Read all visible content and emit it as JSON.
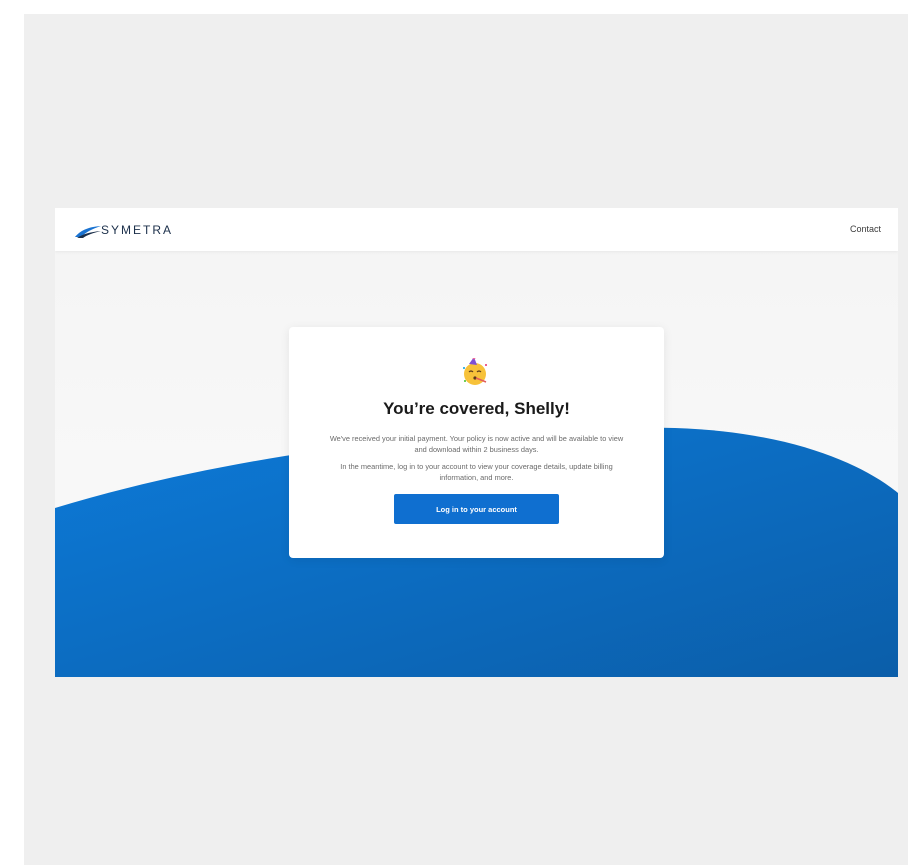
{
  "nav": {
    "brand": "SYMETRA",
    "contact_label": "Contact"
  },
  "card": {
    "emoji_icon": "partying-face-icon",
    "title": "You’re covered, Shelly!",
    "paragraph1": "We've received your initial payment. Your policy is now active and will be available to view and download within 2 business days.",
    "paragraph2": "In the meantime, log in to your account to view your coverage details, update billing information, and more.",
    "button_label": "Log in to your account"
  },
  "colors": {
    "brand_blue": "#0f6fd0",
    "hero_blue_light": "#0d79d6",
    "hero_blue_dark": "#0b5fae",
    "page_background": "#efefef",
    "navbar_background": "#ffffff",
    "logo_text": "#1b2f4a"
  }
}
